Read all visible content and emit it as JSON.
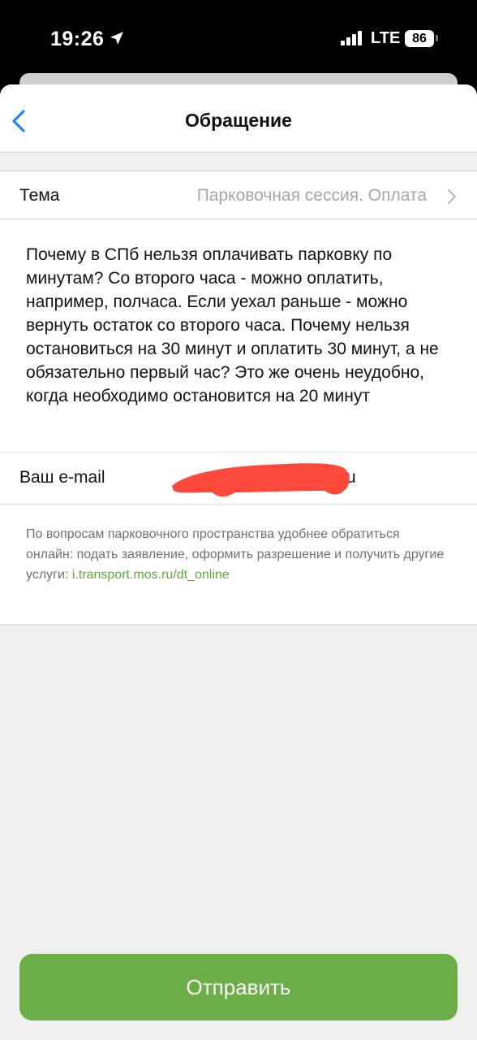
{
  "status_bar": {
    "time": "19:26",
    "carrier": "LTE",
    "battery": "86"
  },
  "nav": {
    "title": "Обращение",
    "back_icon": "chevron-left-icon"
  },
  "topic": {
    "label": "Тема",
    "value": "Парковочная сессия. Оплата",
    "chevron_icon": "chevron-right-icon"
  },
  "message": {
    "text": "Почему в СПб нельзя оплачивать парковку по минутам? Со второго часа - можно оплатить, например, полчаса. Если уехал раньше - можно вернуть остаток со второго часа. Почему нельзя остановиться на 30 минут и оплатить 30 минут, а не обязательно первый час? Это же очень неудобно, когда необходимо остановится на 20 минут"
  },
  "email": {
    "label": "Ваш e-mail",
    "value_visible": "ru"
  },
  "info": {
    "text": "По вопросам парковочного пространства удобнее обратиться онлайн: подать заявление, оформить разрешение и получить другие услуги: ",
    "link": "i.transport.mos.ru/dt_online"
  },
  "submit": {
    "label": "Отправить"
  },
  "colors": {
    "accent": "#6bad46",
    "link": "#63a83d",
    "back_icon": "#1e88e5",
    "redaction": "#fb4a3c"
  }
}
